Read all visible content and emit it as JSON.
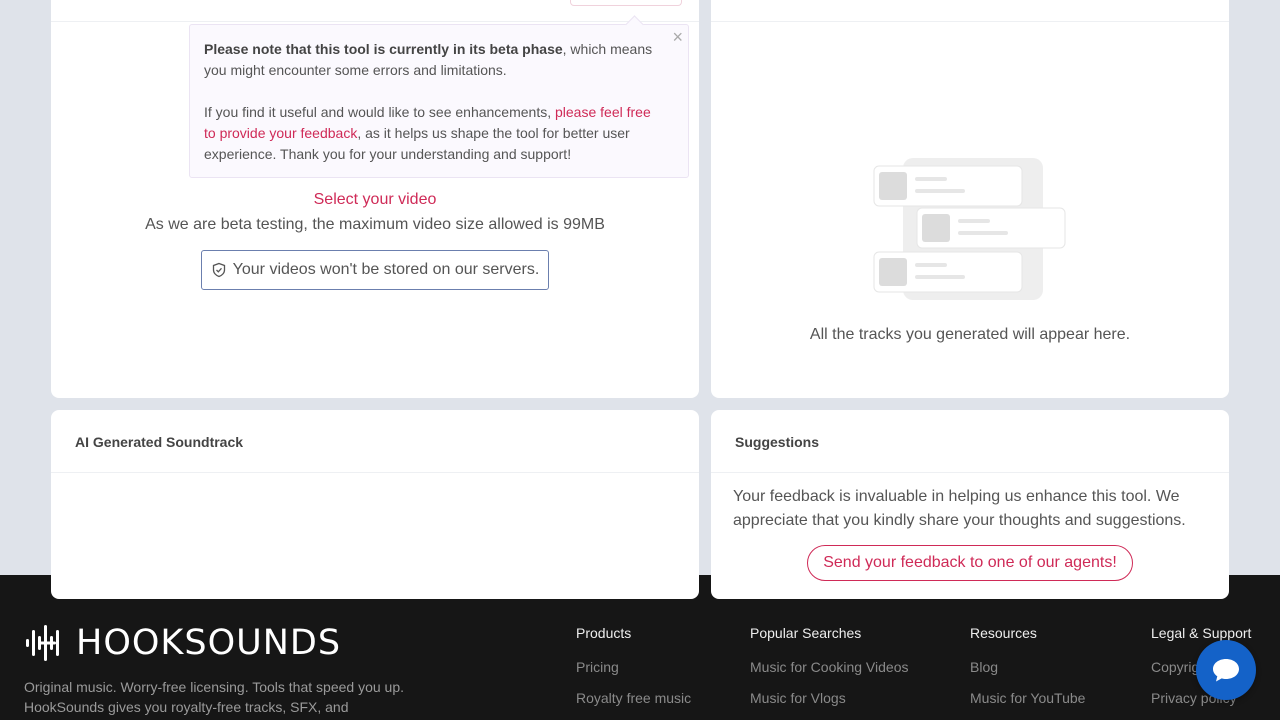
{
  "upload": {
    "notice": {
      "bold": "Please note that this tool is currently in its beta phase",
      "text1": ", which means you might encounter some errors and limitations.",
      "text2_pre": "If you find it useful and would like to see enhancements, ",
      "link": "please feel free to provide your feedback",
      "text2_post": ", as it helps us shape the tool for better user experience. Thank you for your understanding and support!",
      "close": "×"
    },
    "select_video": "Select your video",
    "max_size": "As we are beta testing, the maximum video size allowed is 99MB",
    "storage_note": "Your videos won't be stored on our servers."
  },
  "tracks": {
    "empty_text": "All the tracks you generated will appear here."
  },
  "soundtrack": {
    "title": "AI Generated Soundtrack"
  },
  "suggestions": {
    "title": "Suggestions",
    "text": "Your feedback is invaluable in helping us enhance this tool. We appreciate that you kindly share your thoughts and suggestions.",
    "button": "Send your feedback to one of our agents!"
  },
  "footer": {
    "logo": "HOOKSOUNDS",
    "description": "Original music. Worry-free licensing. Tools that speed you up. HookSounds gives you royalty-free tracks, SFX, and",
    "columns": {
      "products": {
        "title": "Products",
        "links": [
          "Pricing",
          "Royalty free music"
        ]
      },
      "popular": {
        "title": "Popular Searches",
        "links": [
          "Music for Cooking Videos",
          "Music for Vlogs"
        ]
      },
      "resources": {
        "title": "Resources",
        "links": [
          "Blog",
          "Music for YouTube"
        ]
      },
      "legal": {
        "title": "Legal & Support",
        "links": [
          "Copyright",
          "Privacy policy"
        ]
      }
    }
  },
  "colors": {
    "accent": "#cf2a57",
    "footer_bg": "#161616",
    "page_bg": "#dfe3ea",
    "chat": "#1462c8"
  },
  "icons": {
    "shield": "shield-check-icon",
    "chat": "chat-bubble-icon",
    "logo": "hooksounds-waveform-logo",
    "close": "close-icon"
  }
}
